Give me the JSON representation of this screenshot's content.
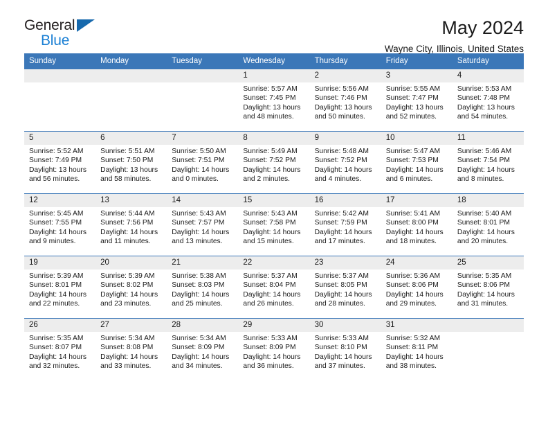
{
  "brand": {
    "line1": "General",
    "line2": "Blue",
    "triangle_color": "#1769ad",
    "blue_color": "#1a7fd4"
  },
  "header": {
    "title": "May 2024",
    "subtitle": "Wayne City, Illinois, United States"
  },
  "theme": {
    "header_blue": "#3b77b8",
    "daynum_gray": "#ededed"
  },
  "weekdays": [
    "Sunday",
    "Monday",
    "Tuesday",
    "Wednesday",
    "Thursday",
    "Friday",
    "Saturday"
  ],
  "weeks": [
    [
      {
        "empty": true
      },
      {
        "empty": true
      },
      {
        "empty": true
      },
      {
        "day": "1",
        "sunrise": "Sunrise: 5:57 AM",
        "sunset": "Sunset: 7:45 PM",
        "daylight1": "Daylight: 13 hours",
        "daylight2": "and 48 minutes."
      },
      {
        "day": "2",
        "sunrise": "Sunrise: 5:56 AM",
        "sunset": "Sunset: 7:46 PM",
        "daylight1": "Daylight: 13 hours",
        "daylight2": "and 50 minutes."
      },
      {
        "day": "3",
        "sunrise": "Sunrise: 5:55 AM",
        "sunset": "Sunset: 7:47 PM",
        "daylight1": "Daylight: 13 hours",
        "daylight2": "and 52 minutes."
      },
      {
        "day": "4",
        "sunrise": "Sunrise: 5:53 AM",
        "sunset": "Sunset: 7:48 PM",
        "daylight1": "Daylight: 13 hours",
        "daylight2": "and 54 minutes."
      }
    ],
    [
      {
        "day": "5",
        "sunrise": "Sunrise: 5:52 AM",
        "sunset": "Sunset: 7:49 PM",
        "daylight1": "Daylight: 13 hours",
        "daylight2": "and 56 minutes."
      },
      {
        "day": "6",
        "sunrise": "Sunrise: 5:51 AM",
        "sunset": "Sunset: 7:50 PM",
        "daylight1": "Daylight: 13 hours",
        "daylight2": "and 58 minutes."
      },
      {
        "day": "7",
        "sunrise": "Sunrise: 5:50 AM",
        "sunset": "Sunset: 7:51 PM",
        "daylight1": "Daylight: 14 hours",
        "daylight2": "and 0 minutes."
      },
      {
        "day": "8",
        "sunrise": "Sunrise: 5:49 AM",
        "sunset": "Sunset: 7:52 PM",
        "daylight1": "Daylight: 14 hours",
        "daylight2": "and 2 minutes."
      },
      {
        "day": "9",
        "sunrise": "Sunrise: 5:48 AM",
        "sunset": "Sunset: 7:52 PM",
        "daylight1": "Daylight: 14 hours",
        "daylight2": "and 4 minutes."
      },
      {
        "day": "10",
        "sunrise": "Sunrise: 5:47 AM",
        "sunset": "Sunset: 7:53 PM",
        "daylight1": "Daylight: 14 hours",
        "daylight2": "and 6 minutes."
      },
      {
        "day": "11",
        "sunrise": "Sunrise: 5:46 AM",
        "sunset": "Sunset: 7:54 PM",
        "daylight1": "Daylight: 14 hours",
        "daylight2": "and 8 minutes."
      }
    ],
    [
      {
        "day": "12",
        "sunrise": "Sunrise: 5:45 AM",
        "sunset": "Sunset: 7:55 PM",
        "daylight1": "Daylight: 14 hours",
        "daylight2": "and 9 minutes."
      },
      {
        "day": "13",
        "sunrise": "Sunrise: 5:44 AM",
        "sunset": "Sunset: 7:56 PM",
        "daylight1": "Daylight: 14 hours",
        "daylight2": "and 11 minutes."
      },
      {
        "day": "14",
        "sunrise": "Sunrise: 5:43 AM",
        "sunset": "Sunset: 7:57 PM",
        "daylight1": "Daylight: 14 hours",
        "daylight2": "and 13 minutes."
      },
      {
        "day": "15",
        "sunrise": "Sunrise: 5:43 AM",
        "sunset": "Sunset: 7:58 PM",
        "daylight1": "Daylight: 14 hours",
        "daylight2": "and 15 minutes."
      },
      {
        "day": "16",
        "sunrise": "Sunrise: 5:42 AM",
        "sunset": "Sunset: 7:59 PM",
        "daylight1": "Daylight: 14 hours",
        "daylight2": "and 17 minutes."
      },
      {
        "day": "17",
        "sunrise": "Sunrise: 5:41 AM",
        "sunset": "Sunset: 8:00 PM",
        "daylight1": "Daylight: 14 hours",
        "daylight2": "and 18 minutes."
      },
      {
        "day": "18",
        "sunrise": "Sunrise: 5:40 AM",
        "sunset": "Sunset: 8:01 PM",
        "daylight1": "Daylight: 14 hours",
        "daylight2": "and 20 minutes."
      }
    ],
    [
      {
        "day": "19",
        "sunrise": "Sunrise: 5:39 AM",
        "sunset": "Sunset: 8:01 PM",
        "daylight1": "Daylight: 14 hours",
        "daylight2": "and 22 minutes."
      },
      {
        "day": "20",
        "sunrise": "Sunrise: 5:39 AM",
        "sunset": "Sunset: 8:02 PM",
        "daylight1": "Daylight: 14 hours",
        "daylight2": "and 23 minutes."
      },
      {
        "day": "21",
        "sunrise": "Sunrise: 5:38 AM",
        "sunset": "Sunset: 8:03 PM",
        "daylight1": "Daylight: 14 hours",
        "daylight2": "and 25 minutes."
      },
      {
        "day": "22",
        "sunrise": "Sunrise: 5:37 AM",
        "sunset": "Sunset: 8:04 PM",
        "daylight1": "Daylight: 14 hours",
        "daylight2": "and 26 minutes."
      },
      {
        "day": "23",
        "sunrise": "Sunrise: 5:37 AM",
        "sunset": "Sunset: 8:05 PM",
        "daylight1": "Daylight: 14 hours",
        "daylight2": "and 28 minutes."
      },
      {
        "day": "24",
        "sunrise": "Sunrise: 5:36 AM",
        "sunset": "Sunset: 8:06 PM",
        "daylight1": "Daylight: 14 hours",
        "daylight2": "and 29 minutes."
      },
      {
        "day": "25",
        "sunrise": "Sunrise: 5:35 AM",
        "sunset": "Sunset: 8:06 PM",
        "daylight1": "Daylight: 14 hours",
        "daylight2": "and 31 minutes."
      }
    ],
    [
      {
        "day": "26",
        "sunrise": "Sunrise: 5:35 AM",
        "sunset": "Sunset: 8:07 PM",
        "daylight1": "Daylight: 14 hours",
        "daylight2": "and 32 minutes."
      },
      {
        "day": "27",
        "sunrise": "Sunrise: 5:34 AM",
        "sunset": "Sunset: 8:08 PM",
        "daylight1": "Daylight: 14 hours",
        "daylight2": "and 33 minutes."
      },
      {
        "day": "28",
        "sunrise": "Sunrise: 5:34 AM",
        "sunset": "Sunset: 8:09 PM",
        "daylight1": "Daylight: 14 hours",
        "daylight2": "and 34 minutes."
      },
      {
        "day": "29",
        "sunrise": "Sunrise: 5:33 AM",
        "sunset": "Sunset: 8:09 PM",
        "daylight1": "Daylight: 14 hours",
        "daylight2": "and 36 minutes."
      },
      {
        "day": "30",
        "sunrise": "Sunrise: 5:33 AM",
        "sunset": "Sunset: 8:10 PM",
        "daylight1": "Daylight: 14 hours",
        "daylight2": "and 37 minutes."
      },
      {
        "day": "31",
        "sunrise": "Sunrise: 5:32 AM",
        "sunset": "Sunset: 8:11 PM",
        "daylight1": "Daylight: 14 hours",
        "daylight2": "and 38 minutes."
      },
      {
        "empty": true
      }
    ]
  ]
}
